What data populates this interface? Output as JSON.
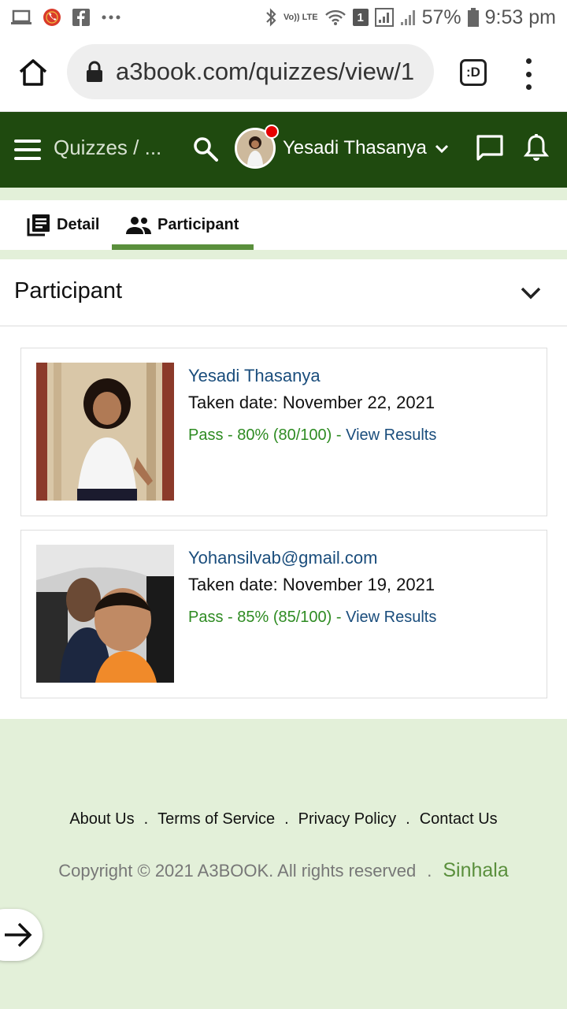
{
  "status_bar": {
    "battery": "57%",
    "time": "9:53 pm",
    "icons": [
      "laptop-icon",
      "phone-call-icon",
      "facebook-icon",
      "more-dots-icon",
      "bluetooth-icon",
      "volte-icon",
      "wifi-icon",
      "sim-1-icon",
      "signal-icon",
      "battery-icon"
    ],
    "volte_label": "Vo)) LTE",
    "sim_label": "1"
  },
  "browser": {
    "url": "a3book.com/quizzes/view/1",
    "tabs_label": ":D"
  },
  "app_header": {
    "breadcrumb": "Quizzes / ...",
    "username": "Yesadi Thasanya",
    "bg_color": "#1f4a0f"
  },
  "tabs": [
    {
      "label": "Detail",
      "icon": "book-icon",
      "active": false
    },
    {
      "label": "Participant",
      "icon": "people-icon",
      "active": true
    }
  ],
  "panel": {
    "title": "Participant"
  },
  "participants": [
    {
      "name": "Yesadi Thasanya",
      "taken_date": "Taken date: November 22, 2021",
      "result": "Pass - 80% (80/100) - ",
      "link": "View Results"
    },
    {
      "name": "Yohansilvab@gmail.com",
      "taken_date": "Taken date: November 19, 2021",
      "result": "Pass - 85% (85/100) - ",
      "link": "View Results"
    }
  ],
  "footer": {
    "links": [
      "About Us",
      "Terms of Service",
      "Privacy Policy",
      "Contact Us"
    ],
    "separator": ".",
    "copyright": "Copyright © 2021 A3BOOK. All rights reserved",
    "language": "Sinhala"
  },
  "colors": {
    "accent_green": "#5a8f3c",
    "link_blue": "#1a4d7c",
    "pass_green": "#2e8b22",
    "page_bg": "#e3f0d9"
  }
}
